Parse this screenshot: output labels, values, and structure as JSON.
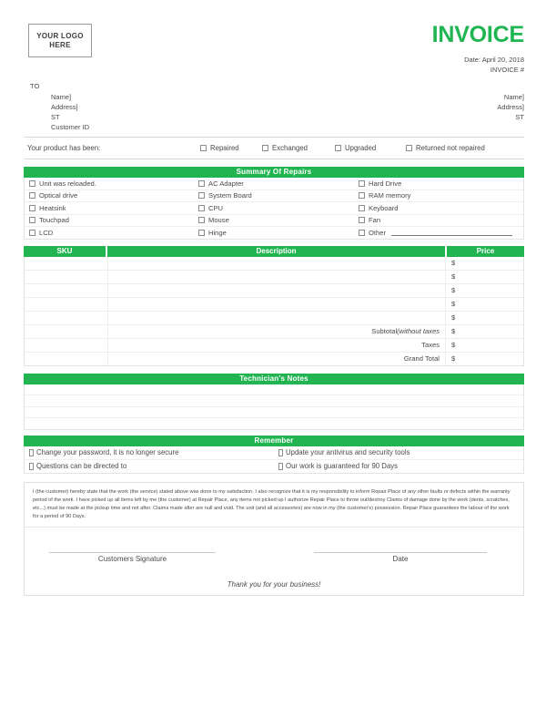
{
  "header": {
    "logo_line1": "YOUR LOGO",
    "logo_line2": "HERE",
    "title": "INVOICE",
    "date": "Date: April 20, 2018",
    "invoice_number": "INVOICE #",
    "accent_color": "#21b451"
  },
  "addresses": {
    "to_label": "TO",
    "to_name": "Name]",
    "to_address": "Address]",
    "to_state": "ST",
    "customer_id": "Customer ID",
    "from_name": "Name]",
    "from_address": "Address]",
    "from_state": "ST"
  },
  "status": {
    "label": "Your product has been:",
    "options": [
      "Repaired",
      "Exchanged",
      "Upgraded",
      "Returned not repaired"
    ]
  },
  "repairs": {
    "heading": "Summary Of Repairs",
    "rows": [
      [
        "Unit was reloaded.",
        "AC Adapter",
        "Hard Drive"
      ],
      [
        "Optical drive",
        "System Board",
        "RAM memory"
      ],
      [
        "Heatsink",
        "CPU",
        "Keyboard"
      ],
      [
        "Touchpad",
        "Mouse",
        "Fan"
      ],
      [
        "LCD",
        "Hinge",
        "Other"
      ]
    ]
  },
  "items": {
    "columns": [
      "SKU",
      "Description",
      "Price"
    ],
    "blank_rows": 5,
    "currency_symbol": "$",
    "totals": [
      {
        "label": "Subtotal ",
        "label_italic": "(without taxes",
        "value": "$"
      },
      {
        "label": "Taxes",
        "label_italic": "",
        "value": "$"
      },
      {
        "label": "Grand Total",
        "label_italic": "",
        "value": "$"
      }
    ]
  },
  "notes": {
    "heading": "Technician's Notes",
    "blank_lines": 4
  },
  "remember": {
    "heading": "Remember",
    "rows": [
      [
        "Change your password, it is no longer secure",
        "Update your antivirus and security tools"
      ],
      [
        "Questions can be directed to",
        "Our work is guaranteed for 90 Days"
      ]
    ]
  },
  "legal": {
    "text": "I (the customer) hereby state that the work (the service) stated above was done to my satisfaction. I also recognize that it is my responsibility to inform Repair Place of any other faults or defects within the warranty period of the work. I have picked up all items left by me (the customer) at Repair Place, any items not picked up I authorize Repair Place to throw out/destroy  Claims of damage done by the work (dents, scratches, etc...) must be made at the pickup time and not after. Claims made after are null and void. The unit (and all accessories) are now in my (the customer's) possession. Repair Place guarantees the labour of the work for a period of 90 Days."
  },
  "signature": {
    "customer_label": "Customers Signature",
    "date_label": "Date",
    "thanks": "Thank you for your business!"
  }
}
